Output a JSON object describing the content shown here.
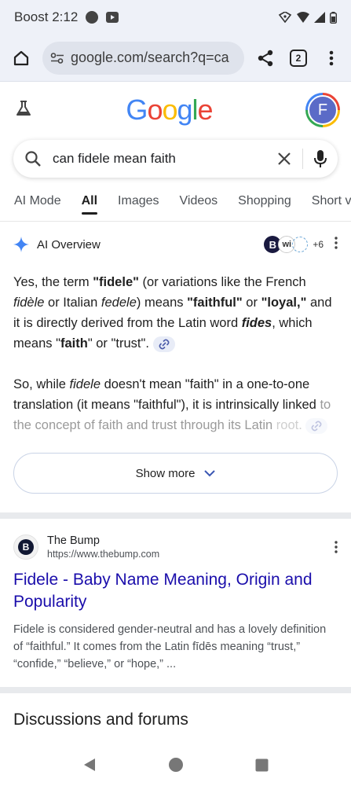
{
  "status_bar": {
    "carrier_time": "Boost 2:12"
  },
  "browser": {
    "url": "google.com/search?q=ca",
    "tab_count": "2"
  },
  "google": {
    "logo_letters": [
      {
        "ch": "G",
        "color": "#4285f4"
      },
      {
        "ch": "o",
        "color": "#ea4335"
      },
      {
        "ch": "o",
        "color": "#fbbc04"
      },
      {
        "ch": "g",
        "color": "#4285f4"
      },
      {
        "ch": "l",
        "color": "#34a853"
      },
      {
        "ch": "e",
        "color": "#ea4335"
      }
    ],
    "avatar_initial": "F",
    "search_query": "can fidele mean faith",
    "tabs": [
      "AI Mode",
      "All",
      "Images",
      "Videos",
      "Shopping",
      "Short vi"
    ]
  },
  "ai_overview": {
    "title": "AI Overview",
    "source_b": "B",
    "source_wi": "wi",
    "source_extra": "+6",
    "p1": {
      "t1": "Yes, the term ",
      "b1": "\"fidele\"",
      "t2": " (or variations like the French ",
      "i1": "fidèle",
      "t3": " or Italian ",
      "i2": "fedele",
      "t4": ") means ",
      "b2": "\"faithful\"",
      "t5": " or ",
      "b3": "\"loyal,\"",
      "t6": " and it is directly derived from the Latin word ",
      "bi1": "fides",
      "t7": ", which means \"",
      "b4": "faith",
      "t8": "\" or \"trust\"."
    },
    "p2": {
      "t1": "So, while ",
      "i1": "fidele",
      "t2": " doesn't mean \"faith\" in a one-to-one translation (it means \"faithful\"), it is intrinsically linked",
      "t3": " to the concept of faith and trust through its Latin",
      "t4": " root."
    },
    "show_more": "Show more"
  },
  "result": {
    "favicon_letter": "B",
    "site_name": "The Bump",
    "site_url": "https://www.thebump.com",
    "title": "Fidele - Baby Name Meaning, Origin and Popularity",
    "snippet": "Fidele is considered gender-neutral and has a lovely definition of “faithful.” It comes from the Latin fīdēs meaning “trust,” “confide,” “believe,” or “hope,” ..."
  },
  "discussions": {
    "heading": "Discussions and forums"
  },
  "colors": {
    "link": "#1a0dab",
    "ai_accent": "#4285f4"
  }
}
